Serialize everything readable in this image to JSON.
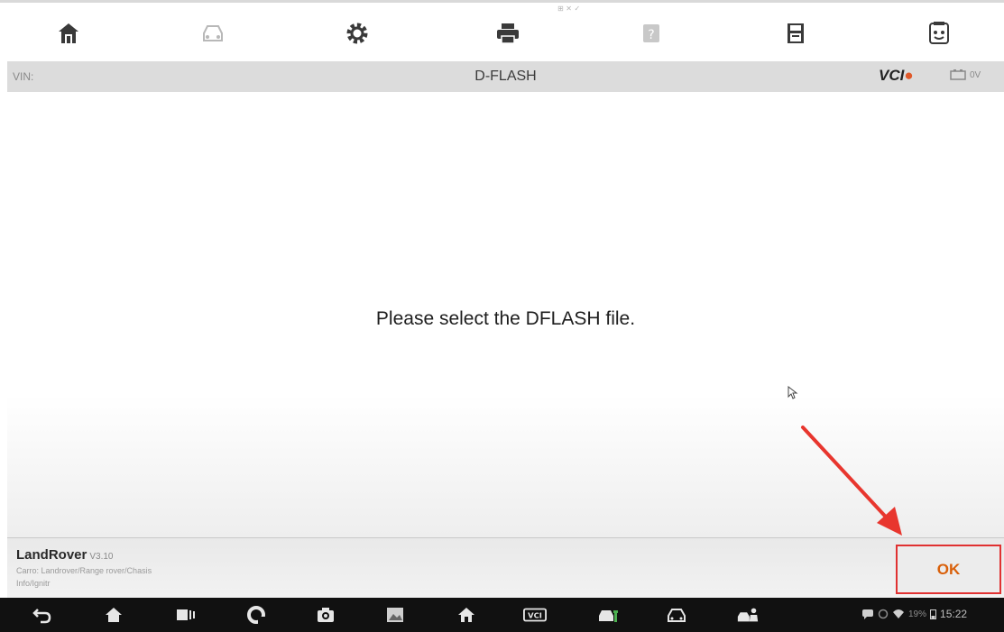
{
  "toolbar": {
    "items": [
      "home-icon",
      "vehicle-icon",
      "settings-icon",
      "print-icon",
      "help-icon",
      "save-icon",
      "data-manager-icon"
    ],
    "tiny_label": "⊞ ✕ ✓"
  },
  "vin_bar": {
    "vin_label": "VIN:",
    "title": "D-FLASH",
    "vci_text": "VCI",
    "voltage": "0V"
  },
  "main": {
    "message": "Please select the DFLASH file."
  },
  "footer": {
    "make": "LandRover",
    "version": "V3.10",
    "path": "Carro: Landrover/Range rover/Chasis",
    "info": "Info/Ignitr"
  },
  "actions": {
    "ok_label": "OK"
  },
  "colors": {
    "accent_orange": "#d9600a",
    "highlight_red": "#e03131",
    "header_gray": "#dcdcdc",
    "navbar_black": "#111111"
  },
  "navbar": {
    "icons": [
      "back-icon",
      "home-icon",
      "recent-apps-icon",
      "browser-icon",
      "camera-icon",
      "screenshot-icon",
      "autel-home-icon",
      "vci-icon",
      "car-diagnose-icon",
      "car-icon",
      "car-service-icon"
    ],
    "battery": "19%",
    "time": "15:22"
  }
}
